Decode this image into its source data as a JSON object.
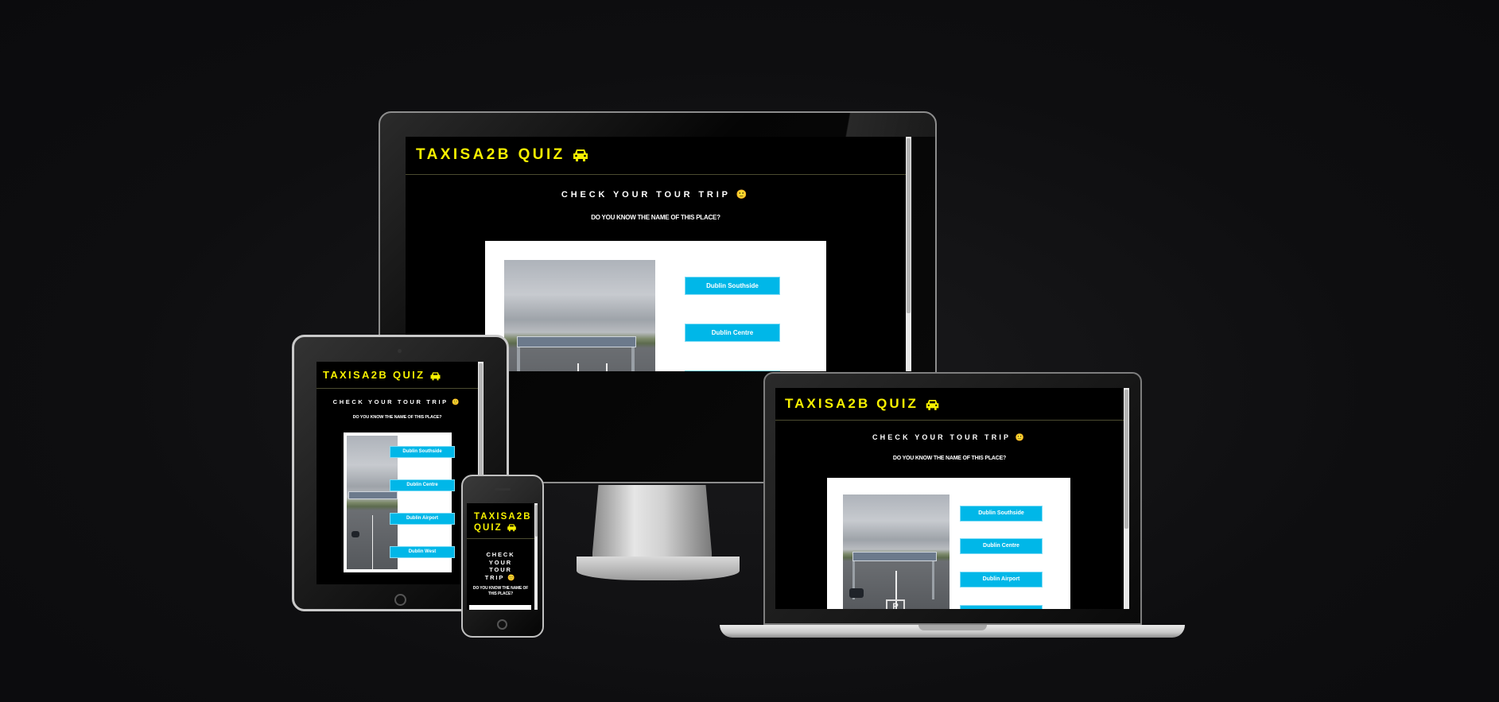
{
  "app": {
    "title": "TAXISA2B QUIZ",
    "title_wrapped_line1": "TAXISA2B",
    "title_wrapped_line2": "QUIZ",
    "subtitle": "CHECK YOUR TOUR TRIP 🙂",
    "subtitle_lines": [
      "CHECK",
      "YOUR",
      "TOUR",
      "TRIP 🙂"
    ],
    "question": "DO YOU KNOW THE NAME OF THIS PLACE?",
    "question_lines": [
      "DO YOU KNOW THE NAME OF",
      "THIS PLACE?"
    ],
    "photo_sign": "P"
  },
  "options": [
    {
      "label": "Dublin Southside"
    },
    {
      "label": "Dublin Centre"
    },
    {
      "label": "Dublin Airport"
    },
    {
      "label": "Dublin West"
    }
  ],
  "icons": {
    "taxi": "taxi-icon",
    "smiley": "smiley-icon"
  },
  "colors": {
    "background": "#0e0e10",
    "title": "#f6f000",
    "option_button": "#00b7e8",
    "card": "#ffffff",
    "screen": "#000000"
  }
}
